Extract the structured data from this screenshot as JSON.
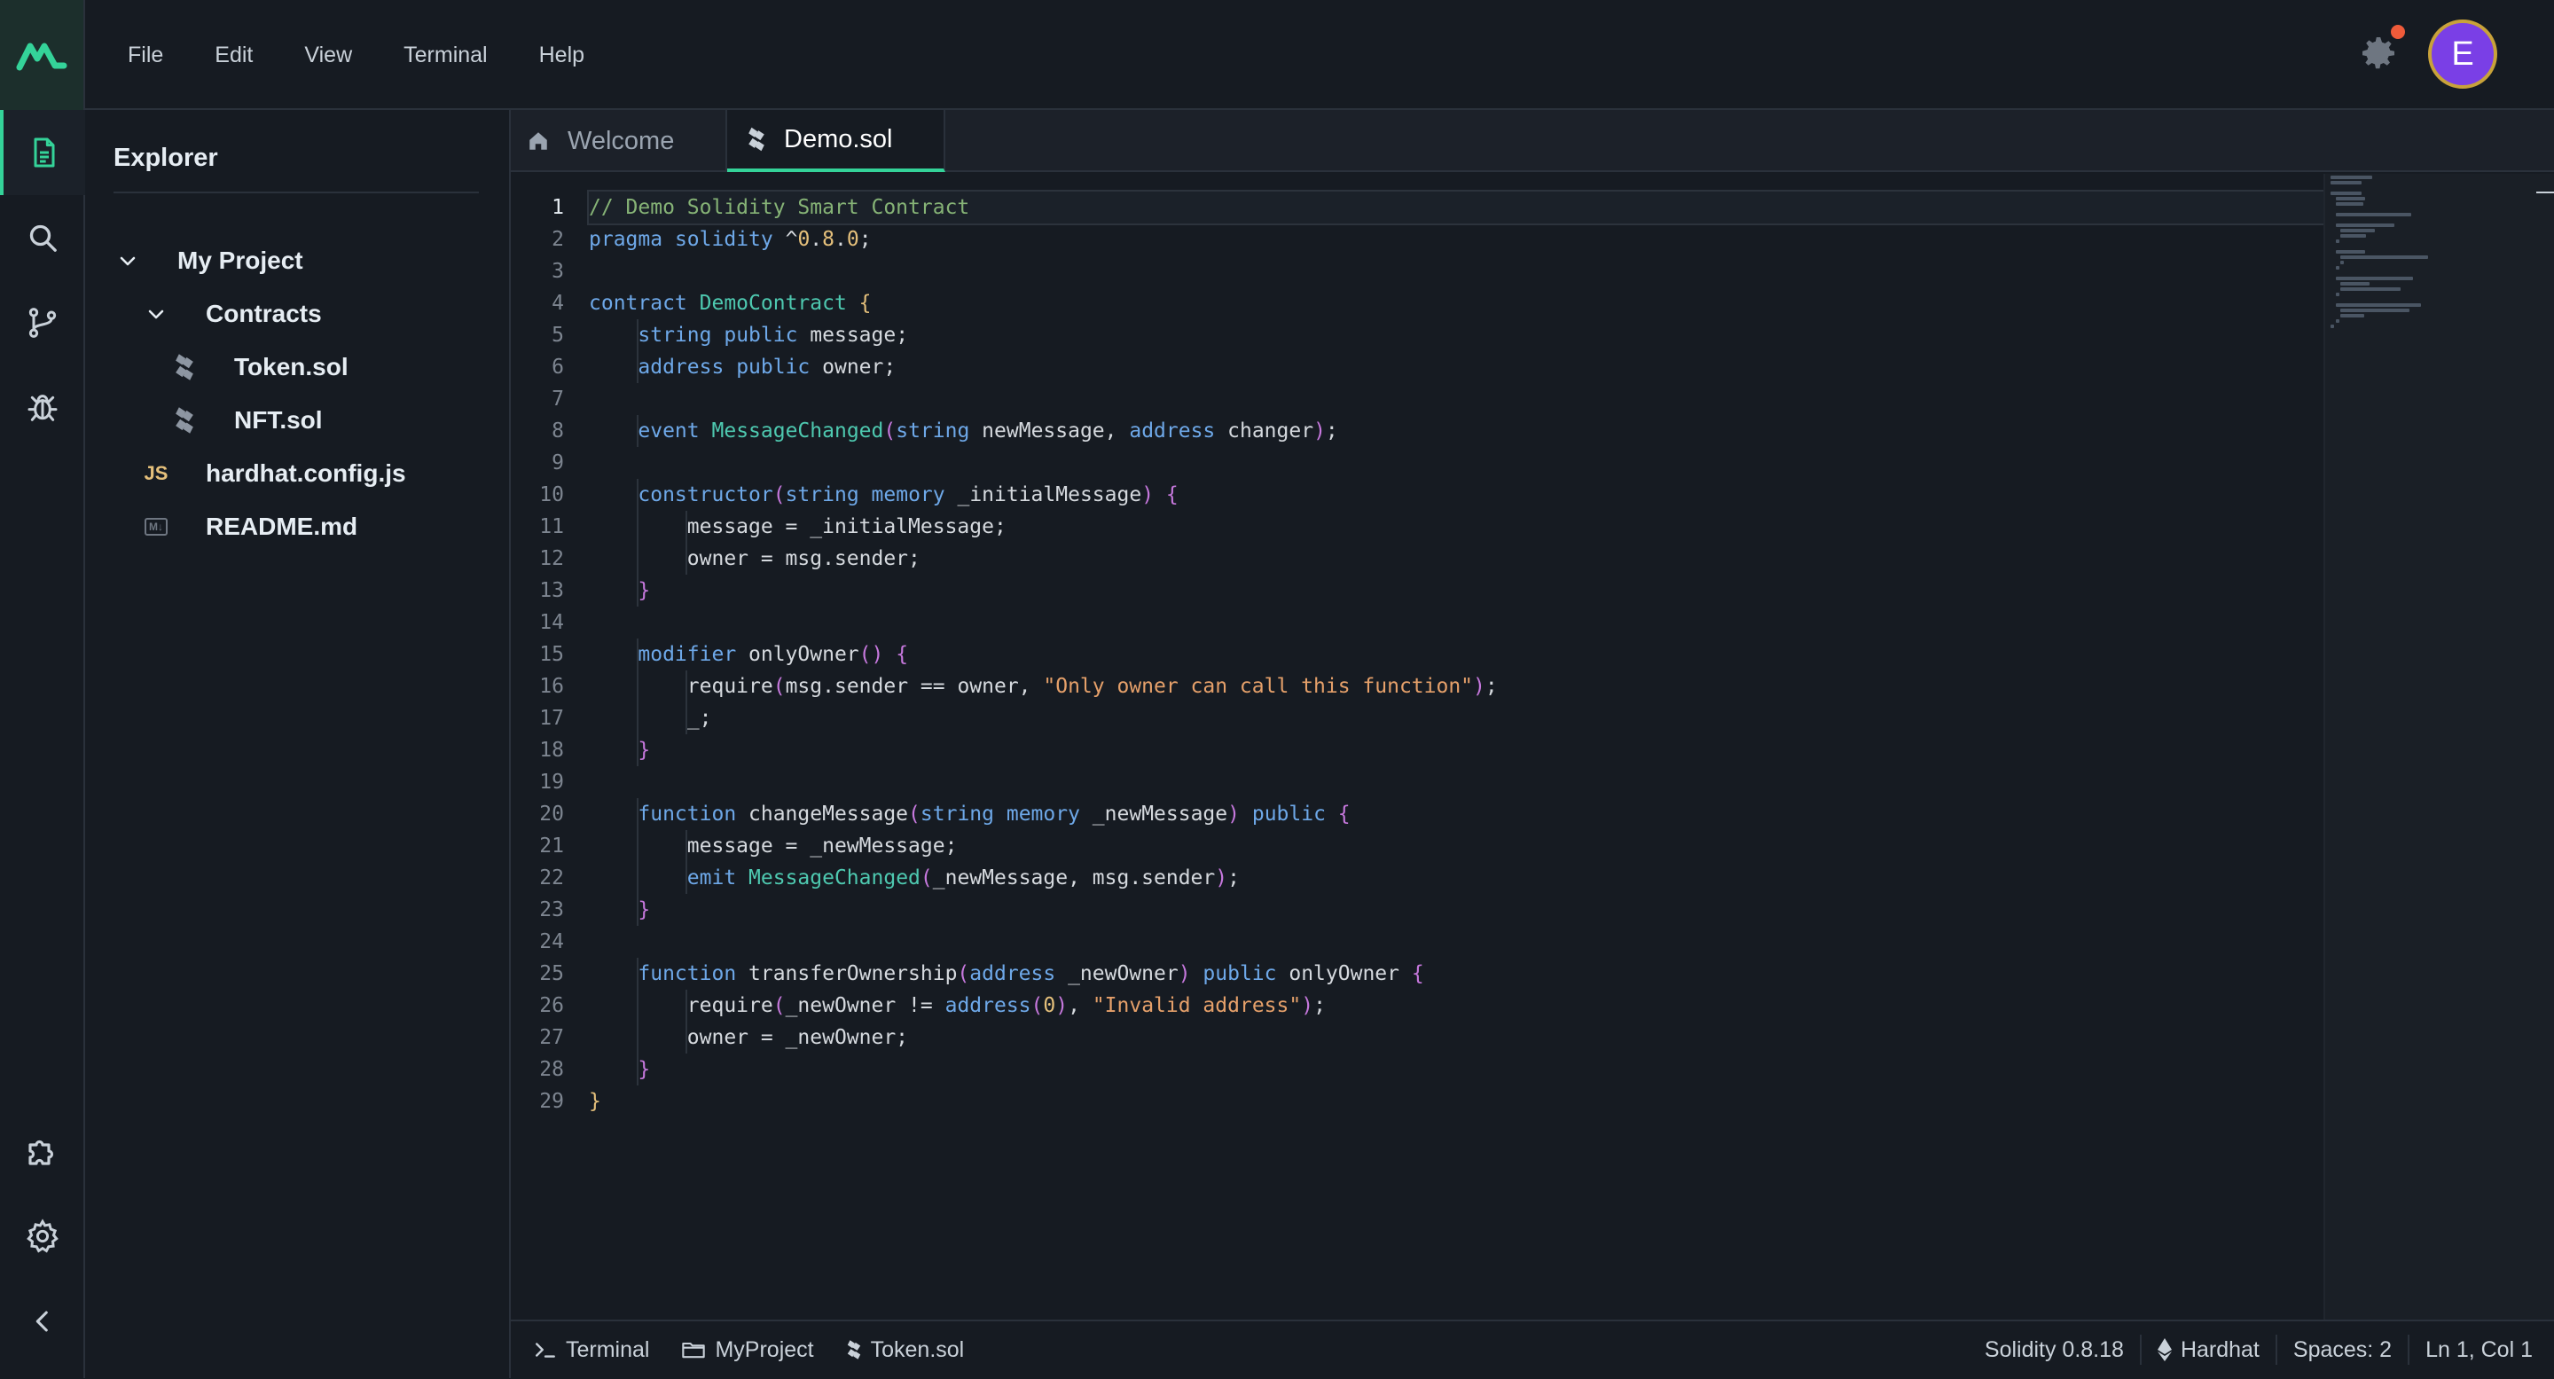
{
  "colors": {
    "accent": "#34d399",
    "background": "#161b22",
    "avatar_bg": "#7a3fe6",
    "notification": "#ef5b3a"
  },
  "menu": {
    "items": [
      "File",
      "Edit",
      "View",
      "Terminal",
      "Help"
    ]
  },
  "user": {
    "avatar_initial": "E"
  },
  "activity_bar": {
    "top": [
      "file-icon",
      "search-icon",
      "source-control-icon",
      "debug-icon"
    ],
    "bottom": [
      "extensions-icon",
      "settings-icon",
      "collapse-icon"
    ]
  },
  "explorer": {
    "title": "Explorer",
    "tree": [
      {
        "label": "My Project",
        "icon": "chevron-down-icon",
        "depth": 0
      },
      {
        "label": "Contracts",
        "icon": "chevron-down-icon",
        "depth": 1
      },
      {
        "label": "Token.sol",
        "icon": "solidity-icon",
        "depth": 2
      },
      {
        "label": "NFT.sol",
        "icon": "solidity-icon",
        "depth": 2
      },
      {
        "label": "hardhat.config.js",
        "icon": "js-icon",
        "icon_text": "JS",
        "depth": 1
      },
      {
        "label": "README.md",
        "icon": "markdown-icon",
        "icon_text": "M↓",
        "depth": 1
      }
    ]
  },
  "tabs": [
    {
      "label": "Welcome",
      "icon": "home-icon",
      "active": false
    },
    {
      "label": "Demo.sol",
      "icon": "solidity-icon",
      "active": true
    }
  ],
  "editor": {
    "current_line": 1,
    "lines": [
      "// Demo Solidity Smart Contract",
      "pragma solidity ^0.8.0;",
      "",
      "contract DemoContract {",
      "    string public message;",
      "    address public owner;",
      "",
      "    event MessageChanged(string newMessage, address changer);",
      "",
      "    constructor(string memory _initialMessage) {",
      "        message = _initialMessage;",
      "        owner = msg.sender;",
      "    }",
      "",
      "    modifier onlyOwner() {",
      "        require(msg.sender == owner, \"Only owner can call this function\");",
      "        _;",
      "    }",
      "",
      "    function changeMessage(string memory _newMessage) public {",
      "        message = _newMessage;",
      "        emit MessageChanged(_newMessage, msg.sender);",
      "    }",
      "",
      "    function transferOwnership(address _newOwner) public onlyOwner {",
      "        require(_newOwner != address(0), \"Invalid address\");",
      "        owner = _newOwner;",
      "    }",
      "}"
    ]
  },
  "statusbar": {
    "left": [
      {
        "label": "Terminal",
        "icon": "terminal-icon"
      },
      {
        "label": "MyProject",
        "icon": "folder-icon"
      },
      {
        "label": "Token.sol",
        "icon": "solidity-icon"
      }
    ],
    "language": "Solidity 0.8.18",
    "framework": "Hardhat",
    "spaces": "Spaces: 2",
    "position": "Ln 1, Col 1"
  }
}
